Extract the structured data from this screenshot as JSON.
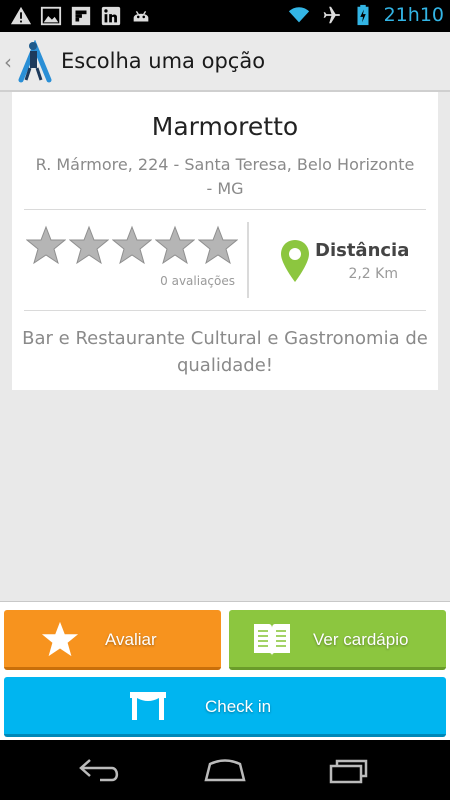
{
  "status_bar": {
    "time": "21h10",
    "icons": [
      "warning-icon",
      "image-icon",
      "flipboard-icon",
      "linkedin-icon",
      "android-icon",
      "wifi-icon",
      "airplane-icon",
      "battery-charging-icon"
    ]
  },
  "action_bar": {
    "title": "Escolha uma opção",
    "up_icon": "chevron-left-icon",
    "logo": "app-logo-icon"
  },
  "place": {
    "name": "Marmoretto",
    "address": "R. Mármore, 224 - Santa Teresa, Belo Horizonte - MG",
    "rating": {
      "stars_max": 5,
      "stars_filled": 0,
      "count_text": "0 avaliações"
    },
    "distance": {
      "label": "Distância",
      "value": "2,2 Km",
      "icon": "location-pin-icon"
    },
    "description": "Bar e Restaurante Cultural e Gastronomia de qualidade!"
  },
  "buttons": {
    "avaliar": {
      "label": "Avaliar",
      "icon": "star-icon",
      "color": "#f7931e"
    },
    "cardapio": {
      "label": "Ver cardápio",
      "icon": "menu-book-icon",
      "color": "#8cc63f"
    },
    "checkin": {
      "label": "Check in",
      "icon": "table-icon",
      "color": "#00b5f0"
    }
  },
  "nav_bar": {
    "icons": [
      "back-icon",
      "home-icon",
      "recent-apps-icon"
    ]
  },
  "colors": {
    "status_accent": "#33b5e5",
    "pin_green": "#8cc63f",
    "star_gray": "#b5b5b5"
  }
}
